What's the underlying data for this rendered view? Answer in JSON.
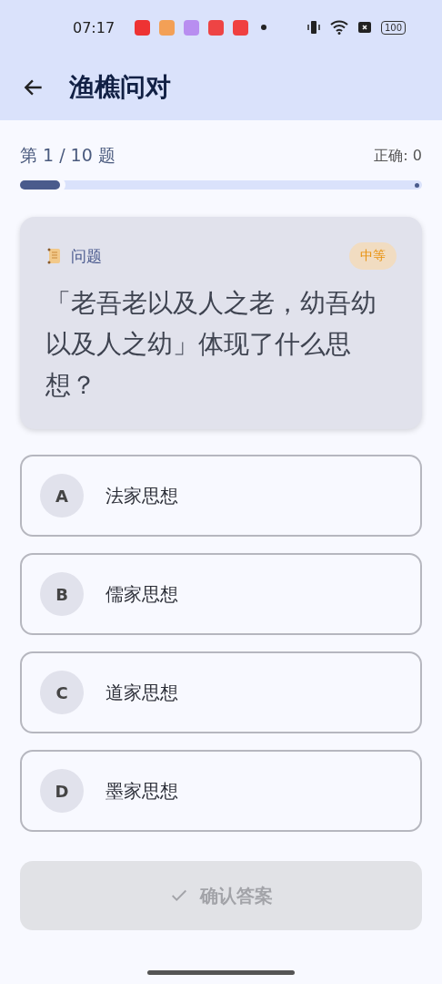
{
  "status_bar": {
    "time": "07:17",
    "battery": "100"
  },
  "app_bar": {
    "title": "渔樵问对"
  },
  "progress": {
    "counter": "第 1 / 10 题",
    "score": "正确: 0",
    "level": 0.1
  },
  "question": {
    "label": "问题",
    "difficulty": "中等",
    "text": "「老吾老以及人之老，幼吾幼以及人之幼」体现了什么思想？"
  },
  "options": [
    {
      "letter": "A",
      "text": "法家思想",
      "selected": false
    },
    {
      "letter": "B",
      "text": "儒家思想",
      "selected": false
    },
    {
      "letter": "C",
      "text": "道家思想",
      "selected": false
    },
    {
      "letter": "D",
      "text": "墨家思想",
      "selected": false
    }
  ],
  "confirm": {
    "label": "确认答案",
    "disabled": true
  }
}
